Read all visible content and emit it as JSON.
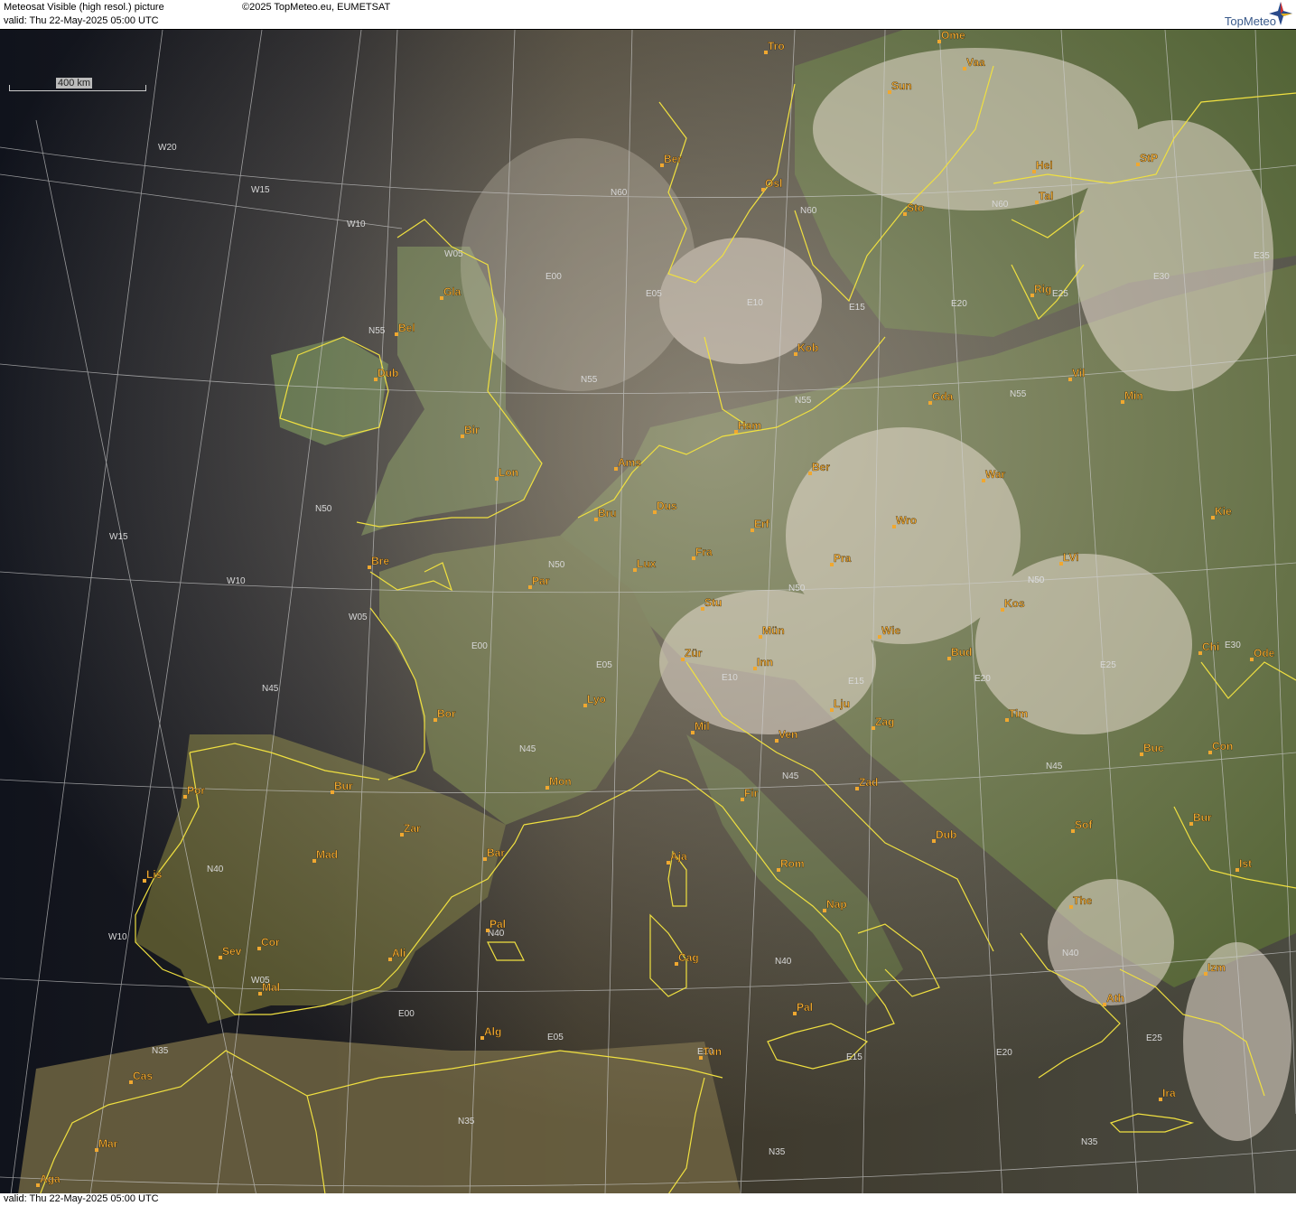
{
  "header": {
    "title": "Meteosat Visible (high resol.) picture",
    "copyright": "©2025 TopMeteo.eu, EUMETSAT",
    "valid": "valid:  Thu  22-May-2025  05:00 UTC",
    "logo": "TopMeteo"
  },
  "footer": {
    "valid": "valid:  Thu  22-May-2025  05:00 UTC"
  },
  "scale_bar": {
    "label": "400 km"
  },
  "colors": {
    "coast": "#f0e040",
    "city": "#f0a830",
    "grid": "#cfcfcf",
    "river": "#8888ff"
  },
  "cities": [
    {
      "name": "Tro"
    },
    {
      "name": "Ome"
    },
    {
      "name": "Vaa"
    },
    {
      "name": "Sun"
    },
    {
      "name": "Ber"
    },
    {
      "name": "Osl"
    },
    {
      "name": "Hel"
    },
    {
      "name": "StP"
    },
    {
      "name": "Tal"
    },
    {
      "name": "Sto"
    },
    {
      "name": "Gla"
    },
    {
      "name": "Bel"
    },
    {
      "name": "Dub"
    },
    {
      "name": "Rig"
    },
    {
      "name": "Kob"
    },
    {
      "name": "Vil"
    },
    {
      "name": "Min"
    },
    {
      "name": "Gda"
    },
    {
      "name": "Ham"
    },
    {
      "name": "Bir"
    },
    {
      "name": "Ams"
    },
    {
      "name": "Lon"
    },
    {
      "name": "Ber"
    },
    {
      "name": "War"
    },
    {
      "name": "Dus"
    },
    {
      "name": "Bru"
    },
    {
      "name": "Erf"
    },
    {
      "name": "Wro"
    },
    {
      "name": "Kie"
    },
    {
      "name": "Lux"
    },
    {
      "name": "Fra"
    },
    {
      "name": "Pra"
    },
    {
      "name": "LVi"
    },
    {
      "name": "Bre"
    },
    {
      "name": "Par"
    },
    {
      "name": "Stu"
    },
    {
      "name": "Kos"
    },
    {
      "name": "Mün"
    },
    {
      "name": "Wie"
    },
    {
      "name": "Bud"
    },
    {
      "name": "Chi"
    },
    {
      "name": "Ode"
    },
    {
      "name": "Zür"
    },
    {
      "name": "Inn"
    },
    {
      "name": "Lyo"
    },
    {
      "name": "Lju"
    },
    {
      "name": "Tim"
    },
    {
      "name": "Bor"
    },
    {
      "name": "Mil"
    },
    {
      "name": "Ven"
    },
    {
      "name": "Zag"
    },
    {
      "name": "Buc"
    },
    {
      "name": "Con"
    },
    {
      "name": "Bur"
    },
    {
      "name": "Mon"
    },
    {
      "name": "Fir"
    },
    {
      "name": "Zad"
    },
    {
      "name": "Por"
    },
    {
      "name": "Zar"
    },
    {
      "name": "Sof"
    },
    {
      "name": "Bur"
    },
    {
      "name": "Mad"
    },
    {
      "name": "Bar"
    },
    {
      "name": "Aja"
    },
    {
      "name": "Rom"
    },
    {
      "name": "Dub"
    },
    {
      "name": "Ist"
    },
    {
      "name": "Lis"
    },
    {
      "name": "The"
    },
    {
      "name": "Nap"
    },
    {
      "name": "Pal"
    },
    {
      "name": "Sev"
    },
    {
      "name": "Cor"
    },
    {
      "name": "Ali"
    },
    {
      "name": "Cag"
    },
    {
      "name": "Izm"
    },
    {
      "name": "Mal"
    },
    {
      "name": "Pal"
    },
    {
      "name": "Ath"
    },
    {
      "name": "Alg"
    },
    {
      "name": "Tun"
    },
    {
      "name": "Cas"
    },
    {
      "name": "Ira"
    },
    {
      "name": "Mar"
    },
    {
      "name": "Aga"
    }
  ],
  "grid_labels": [
    "W20",
    "W15",
    "W10",
    "W05",
    "E00",
    "E05",
    "E10",
    "E15",
    "E20",
    "E25",
    "E30",
    "E35",
    "N60",
    "N60",
    "N60",
    "N55",
    "N55",
    "N55",
    "N55",
    "N50",
    "N50",
    "N50",
    "N50",
    "N50",
    "W15",
    "W10",
    "W05",
    "E00",
    "E05",
    "E10",
    "E15",
    "E20",
    "E25",
    "E30",
    "N45",
    "N45",
    "N45",
    "N45",
    "N40",
    "N40",
    "N40",
    "N40",
    "W10",
    "W05",
    "E00",
    "E05",
    "E10",
    "E15",
    "E20",
    "E25",
    "N35",
    "N35",
    "N35",
    "N35"
  ]
}
